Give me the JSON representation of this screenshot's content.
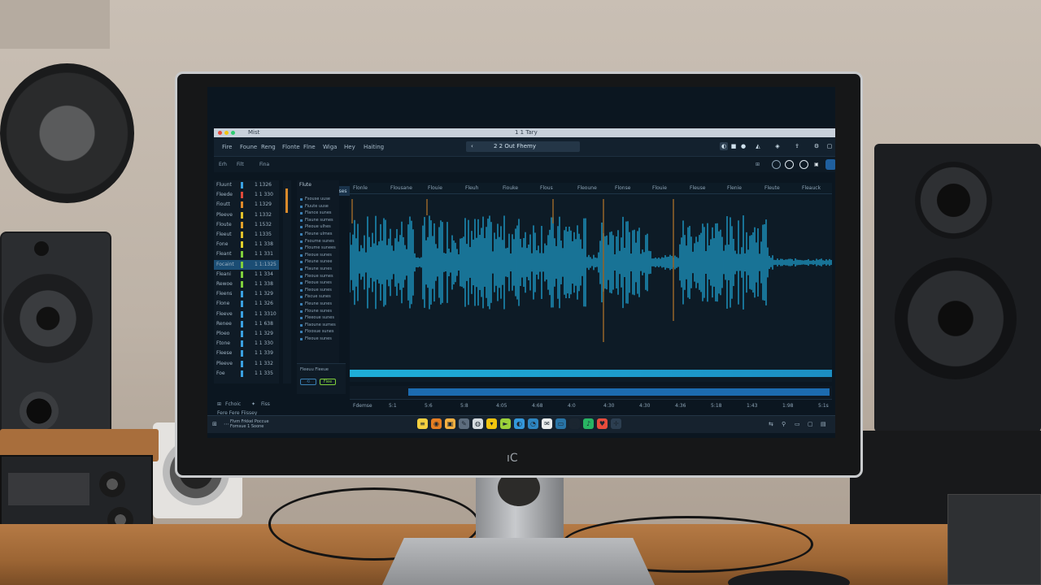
{
  "app": {
    "name": "Mist",
    "window_title": "1 1 Tary",
    "menu": [
      "Fire",
      "Foune",
      "Reng",
      "Flonte",
      "Flne",
      "Wiga",
      "Hey",
      "Haiting"
    ],
    "project": "2 2 Out Fhemy",
    "toolbar_left": [
      "Erh",
      "Filt",
      "Fina"
    ],
    "tab": "Fsusuuk Puuses"
  },
  "mixer": {
    "channels": [
      {
        "name": "Fluunt",
        "value": "1 1326",
        "meter": "#3aa0e0"
      },
      {
        "name": "Fleede",
        "value": "1 1 330",
        "meter": "#e04a3a"
      },
      {
        "name": "Fioutt",
        "value": "1 1329",
        "meter": "#e08a2a"
      },
      {
        "name": "Pleeve",
        "value": "1 1332",
        "meter": "#e0c02a"
      },
      {
        "name": "Floute",
        "value": "1 1532",
        "meter": "#e0a02a"
      },
      {
        "name": "Fleeut",
        "value": "1 1335",
        "meter": "#e0c02a"
      },
      {
        "name": "Fone",
        "value": "1 1 338",
        "meter": "#e0d02a"
      },
      {
        "name": "Fleant",
        "value": "1 1 331",
        "meter": "#7fcf3b"
      },
      {
        "name": "Focaint",
        "value": "1 1:1325",
        "meter": "#7fcf3b"
      },
      {
        "name": "Fleani",
        "value": "1 1 334",
        "meter": "#7fcf3b"
      },
      {
        "name": "Rewoe",
        "value": "1 1 338",
        "meter": "#7fcf3b"
      },
      {
        "name": "Fleens",
        "value": "1 1 329",
        "meter": "#3aa0e0"
      },
      {
        "name": "Flone",
        "value": "1 1 326",
        "meter": "#3aa0e0"
      },
      {
        "name": "Fleeve",
        "value": "1 1 3310",
        "meter": "#3aa0e0"
      },
      {
        "name": "Renee",
        "value": "1 1 638",
        "meter": "#3aa0e0"
      },
      {
        "name": "Ploeo",
        "value": "1 1 329",
        "meter": "#3aa0e0"
      },
      {
        "name": "Ftone",
        "value": "1 1 330",
        "meter": "#3aa0e0"
      },
      {
        "name": "Fleese",
        "value": "1 1 339",
        "meter": "#3aa0e0"
      },
      {
        "name": "Pleeve",
        "value": "1 1 332",
        "meter": "#3aa0e0"
      },
      {
        "name": "Foe",
        "value": "1 1 335",
        "meter": "#3aa0e0"
      }
    ],
    "selected_index": 8
  },
  "browser": {
    "header": "Flute",
    "items": [
      "Fsouse uuse",
      "Fiuute uuse",
      "Flance sunes",
      "Flaune sumes",
      "Pleoue ulhes",
      "Fleune ulmes",
      "Fsoume sunes",
      "Floume sunees",
      "Fleoue sunes",
      "Fleune sunee",
      "Flaune sunes",
      "Fleoue sumes",
      "Fleoue sunes",
      "Fleoue sunes",
      "Fiscue sunes",
      "Fleune sunes",
      "Floune sunes",
      "Fleeoue sunes",
      "Flaoune sumes",
      "Floosue sunes",
      "Fleoue sunes"
    ]
  },
  "ruler": [
    "Flonle",
    "Flousane",
    "Flouie",
    "Fleuh",
    "Fiouke",
    "Flous",
    "Fleoune",
    "Flonse",
    "Flouie",
    "Fleuse",
    "Flenie",
    "Fleute",
    "Fleauck"
  ],
  "timebar": [
    "Fdemse",
    "5:1",
    "5:6",
    "5:8",
    "4:05",
    "4:68",
    "4:0",
    "4:30",
    "4:30",
    "4:36",
    "5:18",
    "1:43",
    "1:98",
    "5:1s"
  ],
  "statusbar": {
    "left": "Fchoic",
    "mid": "Fiss",
    "sub": "Fere Fere Fiissey"
  },
  "midpanel": {
    "label": "Fleeuu Fleeue",
    "btn": "Flee"
  },
  "dock": {
    "text_line1": "Flvm Frkkel Poccue",
    "text_line2": "Fomsue 1 Soone",
    "icons": [
      {
        "name": "notes-icon",
        "glyph": "≡",
        "bg": "#f4d03f"
      },
      {
        "name": "record-icon",
        "glyph": "◉",
        "bg": "#e67e22"
      },
      {
        "name": "folder-icon",
        "glyph": "▣",
        "bg": "#f5b041"
      },
      {
        "name": "tools-icon",
        "glyph": "✎",
        "bg": "#5d6d7e"
      },
      {
        "name": "globe-icon",
        "glyph": "◍",
        "bg": "#d5dbdf"
      },
      {
        "name": "chat-icon",
        "glyph": "▾",
        "bg": "#f1c40f"
      },
      {
        "name": "play-icon",
        "glyph": "►",
        "bg": "#9bd13a"
      },
      {
        "name": "compass-icon",
        "glyph": "◐",
        "bg": "#3498db"
      },
      {
        "name": "browser-icon",
        "glyph": "◔",
        "bg": "#2e86c1"
      },
      {
        "name": "mail-icon",
        "glyph": "✉",
        "bg": "#eaeded"
      },
      {
        "name": "camera-icon",
        "glyph": "▭",
        "bg": "#2874a6"
      },
      {
        "name": "terminal-icon",
        "glyph": "▪",
        "bg": "#1b2631"
      },
      {
        "name": "music-icon",
        "glyph": "♪",
        "bg": "#28b463"
      },
      {
        "name": "heart-icon",
        "glyph": "♥",
        "bg": "#e74c3c"
      },
      {
        "name": "crosshair-icon",
        "glyph": "✛",
        "bg": "#2c3e50"
      }
    ]
  },
  "colors": {
    "accent": "#1eaed8",
    "marker": "#d98a2b",
    "bg": "#0b1620"
  }
}
